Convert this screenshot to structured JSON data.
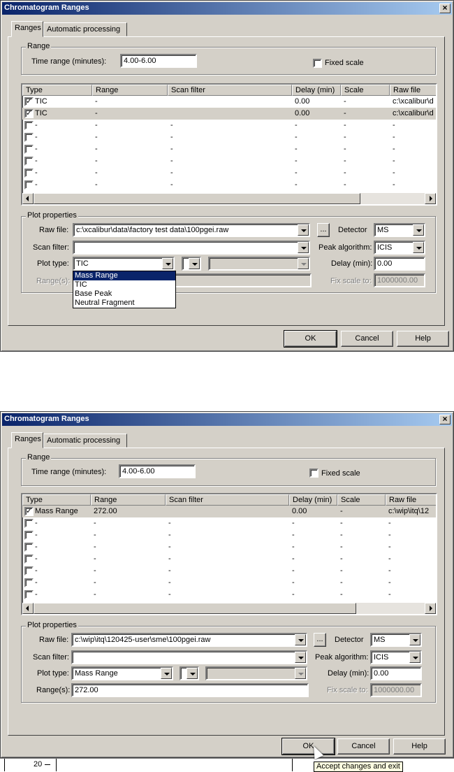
{
  "dialogs": [
    {
      "title": "Chromatogram Ranges",
      "close_icon": "×",
      "tabs": [
        "Ranges",
        "Automatic processing"
      ],
      "range_group_label": "Range",
      "time_range_label": "Time range (minutes):",
      "time_range_value": "4.00-6.00",
      "fixed_scale_label": "Fixed scale",
      "fixed_scale_checked": false,
      "columns": [
        "Type",
        "Range",
        "Scan filter",
        "Delay (min)",
        "Scale",
        "Raw file"
      ],
      "rows": [
        {
          "checked": true,
          "type": "TIC",
          "range": "-",
          "scan": "",
          "delay": "0.00",
          "scale": "-",
          "raw": "c:\\xcalibur\\d"
        },
        {
          "checked": true,
          "type": "TIC",
          "range": "-",
          "scan": "",
          "delay": "0.00",
          "scale": "-",
          "raw": "c:\\xcalibur\\d"
        },
        {
          "checked": false,
          "type": "-",
          "range": "-",
          "scan": "-",
          "delay": "-",
          "scale": "-",
          "raw": "-"
        },
        {
          "checked": false,
          "type": "-",
          "range": "-",
          "scan": "-",
          "delay": "-",
          "scale": "-",
          "raw": "-"
        },
        {
          "checked": false,
          "type": "-",
          "range": "-",
          "scan": "-",
          "delay": "-",
          "scale": "-",
          "raw": "-"
        },
        {
          "checked": false,
          "type": "-",
          "range": "-",
          "scan": "-",
          "delay": "-",
          "scale": "-",
          "raw": "-"
        },
        {
          "checked": false,
          "type": "-",
          "range": "-",
          "scan": "-",
          "delay": "-",
          "scale": "-",
          "raw": "-"
        },
        {
          "checked": false,
          "type": "-",
          "range": "-",
          "scan": "-",
          "delay": "-",
          "scale": "-",
          "raw": "-"
        }
      ],
      "plot_group_label": "Plot properties",
      "raw_file_label": "Raw file:",
      "raw_file_value": "c:\\xcalibur\\data\\factory test data\\100pgei.raw",
      "browse_label": "...",
      "detector_label": "Detector",
      "detector_value": "MS",
      "scan_filter_label": "Scan filter:",
      "scan_filter_value": "",
      "peak_algorithm_label": "Peak algorithm:",
      "peak_algorithm_value": "ICIS",
      "plot_type_label": "Plot type:",
      "plot_type_value": "TIC",
      "delay_label": "Delay (min):",
      "delay_value": "0.00",
      "ranges_label": "Range(s):",
      "ranges_value": "",
      "fix_scale_label": "Fix scale to:",
      "fix_scale_value": "1000000.00",
      "plot_type_options": [
        "Mass Range",
        "TIC",
        "Base Peak",
        "Neutral Fragment"
      ],
      "plot_type_highlighted": "Mass Range",
      "ok_label": "OK",
      "cancel_label": "Cancel",
      "help_label": "Help"
    },
    {
      "title": "Chromatogram Ranges",
      "close_icon": "×",
      "tabs": [
        "Ranges",
        "Automatic processing"
      ],
      "range_group_label": "Range",
      "time_range_label": "Time range (minutes):",
      "time_range_value": "4.00-6.00",
      "fixed_scale_label": "Fixed scale",
      "fixed_scale_checked": false,
      "columns": [
        "Type",
        "Range",
        "Scan filter",
        "Delay (min)",
        "Scale",
        "Raw file"
      ],
      "rows": [
        {
          "checked": true,
          "type": "Mass Range",
          "range": "272.00",
          "scan": "",
          "delay": "0.00",
          "scale": "-",
          "raw": "c:\\wip\\itq\\12"
        },
        {
          "checked": false,
          "type": "-",
          "range": "-",
          "scan": "-",
          "delay": "-",
          "scale": "-",
          "raw": "-"
        },
        {
          "checked": false,
          "type": "-",
          "range": "-",
          "scan": "-",
          "delay": "-",
          "scale": "-",
          "raw": "-"
        },
        {
          "checked": false,
          "type": "-",
          "range": "-",
          "scan": "-",
          "delay": "-",
          "scale": "-",
          "raw": "-"
        },
        {
          "checked": false,
          "type": "-",
          "range": "-",
          "scan": "-",
          "delay": "-",
          "scale": "-",
          "raw": "-"
        },
        {
          "checked": false,
          "type": "-",
          "range": "-",
          "scan": "-",
          "delay": "-",
          "scale": "-",
          "raw": "-"
        },
        {
          "checked": false,
          "type": "-",
          "range": "-",
          "scan": "-",
          "delay": "-",
          "scale": "-",
          "raw": "-"
        },
        {
          "checked": false,
          "type": "-",
          "range": "-",
          "scan": "-",
          "delay": "-",
          "scale": "-",
          "raw": "-"
        }
      ],
      "plot_group_label": "Plot properties",
      "raw_file_label": "Raw file:",
      "raw_file_value": "c:\\wip\\itq\\120425-user\\sme\\100pgei.raw",
      "browse_label": "...",
      "detector_label": "Detector",
      "detector_value": "MS",
      "scan_filter_label": "Scan filter:",
      "scan_filter_value": "",
      "peak_algorithm_label": "Peak algorithm:",
      "peak_algorithm_value": "ICIS",
      "plot_type_label": "Plot type:",
      "plot_type_value": "Mass Range",
      "delay_label": "Delay (min):",
      "delay_value": "0.00",
      "ranges_label": "Range(s):",
      "ranges_value": "272.00",
      "fix_scale_label": "Fix scale to:",
      "fix_scale_value": "1000000.00",
      "ok_label": "OK",
      "cancel_label": "Cancel",
      "help_label": "Help",
      "tooltip": "Accept changes and exit",
      "background_axis_tick": "20"
    }
  ]
}
